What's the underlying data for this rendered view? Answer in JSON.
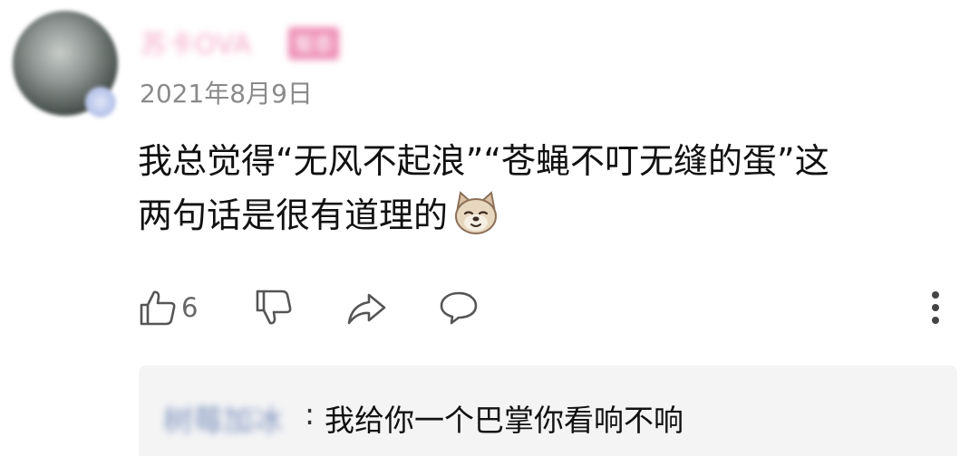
{
  "comment": {
    "username": "苏卡OVA",
    "user_badge": "蜀黍",
    "date": "2021年8月9日",
    "text_line1": "我总觉得“无风不起浪”“苍蝇不叮无缝的蛋”这",
    "text_line2": "两句话是很有道理的",
    "emoji": "dog-face-emoji"
  },
  "actions": {
    "like_count": "6",
    "like_icon": "thumbs-up-icon",
    "dislike_icon": "thumbs-down-icon",
    "share_icon": "share-arrow-icon",
    "comment_icon": "speech-bubble-icon",
    "more_icon": "more-vertical-icon"
  },
  "reply": {
    "username": "树莓加冰",
    "separator": ":",
    "text": "我给你一个巴掌你看响不响"
  },
  "colors": {
    "username": "#f4a7c6",
    "date": "#8a8a8a",
    "reply_username": "#7e94be",
    "reply_background": "#f4f4f5"
  }
}
